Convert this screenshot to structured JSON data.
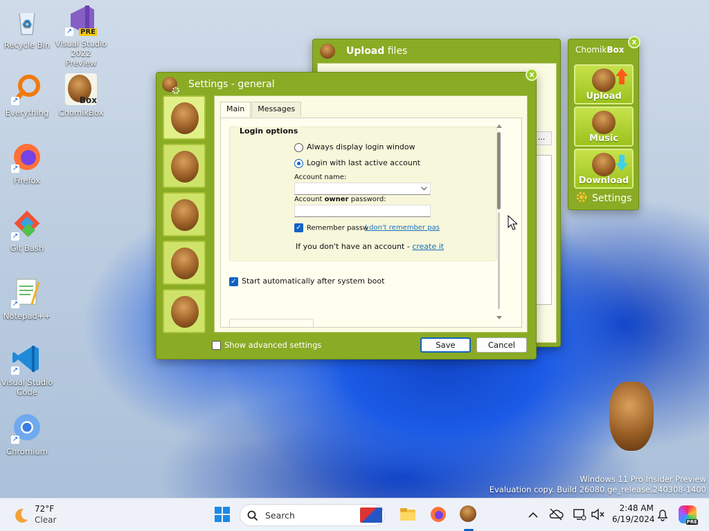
{
  "desktop": {
    "icons": [
      {
        "label": "Recycle Bin"
      },
      {
        "label": "Visual Studio 2022 Preview",
        "badge": "PRE"
      },
      {
        "label": "Everything"
      },
      {
        "label": "ChomikBox",
        "badge": "Box"
      },
      {
        "label": "Firefox"
      },
      {
        "label": "Git Bash"
      },
      {
        "label": "Notepad++"
      },
      {
        "label": "Visual Studio Code"
      },
      {
        "label": "Chromium"
      }
    ],
    "watermark": {
      "line1": "Windows 11 Pro Insider Preview",
      "line2": "Evaluation copy. Build 26080.ge_release.240308-1400"
    }
  },
  "upload_window": {
    "title_bold": "Upload",
    "title_rest": " files",
    "ellipsis": "..."
  },
  "chomikbox_panel": {
    "title_a": "Chomik",
    "title_b": "Box",
    "buttons": [
      {
        "label": "Upload"
      },
      {
        "label": "Music"
      },
      {
        "label": "Download"
      }
    ],
    "settings_label": "Settings",
    "colors": {
      "accent": "#8aab24",
      "button": "#b5d634"
    }
  },
  "settings_dialog": {
    "title": "Settings - general",
    "tabs": [
      {
        "label": "Main",
        "active": true
      },
      {
        "label": "Messages",
        "active": false
      }
    ],
    "login_options": {
      "heading": "Login options",
      "radio_always": "Always display login window",
      "radio_last": "Login with last active account",
      "selected": "radio_last",
      "account_name_label": "Account name:",
      "account_name_value": "",
      "password_label_a": "Account ",
      "password_label_bold": "owner",
      "password_label_b": " password:",
      "password_value": "",
      "remember_label": "Remember passw",
      "remember_checked": true,
      "forgot_link": "I don't remember pas",
      "no_account_text": "If you don't have an account - ",
      "create_link": "create it"
    },
    "autostart_label": "Start automatically after system boot",
    "autostart_checked": true,
    "show_advanced_label": "Show advanced settings",
    "show_advanced_checked": false,
    "save_label": "Save",
    "cancel_label": "Cancel"
  },
  "taskbar": {
    "weather_temp": "72°F",
    "weather_desc": "Clear",
    "search_placeholder": "Search",
    "time": "2:48 AM",
    "date": "6/19/2024",
    "accent": "#1062c4"
  }
}
